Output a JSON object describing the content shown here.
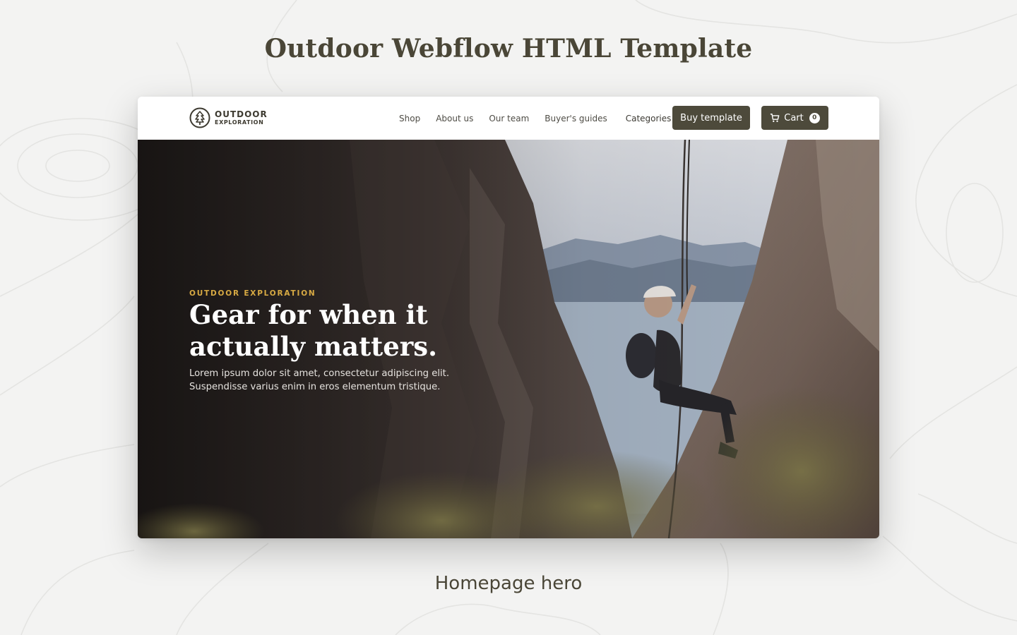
{
  "page": {
    "title": "Outdoor Webflow HTML Template",
    "caption": "Homepage hero"
  },
  "site": {
    "logo": {
      "line1": "OUTDOOR",
      "line2": "EXPLORATION",
      "icon": "pine-tree-icon"
    },
    "nav": {
      "links": [
        "Shop",
        "About us",
        "Our team",
        "Buyer's guides"
      ],
      "categories_label": "Categories",
      "buy_label": "Buy template",
      "cart_label": "Cart",
      "cart_count": "0"
    },
    "hero": {
      "eyebrow": "OUTDOOR EXPLORATION",
      "headline": "Gear for when it actually matters.",
      "subtext": "Lorem ipsum dolor sit amet, consectetur adipiscing elit. Suspendisse varius enim in eros elementum tristique."
    }
  },
  "colors": {
    "background": "#f3f3f2",
    "title_text": "#4a4637",
    "button": "#4d4a3b",
    "eyebrow": "#d8aa43"
  }
}
